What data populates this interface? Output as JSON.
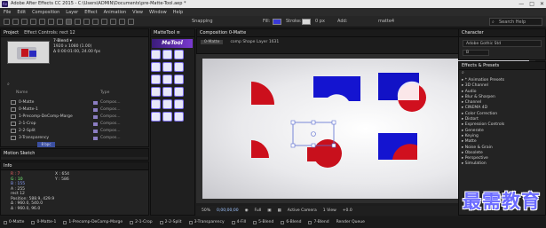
{
  "window": {
    "title": "Adobe After Effects CC 2015 - C:\\Users\\ADMIN\\Documents\\pre-Matte-Tool.aep *",
    "controls": [
      "—",
      "□",
      "✕"
    ]
  },
  "menu": [
    "File",
    "Edit",
    "Composition",
    "Layer",
    "Effect",
    "Animation",
    "View",
    "Window",
    "Help"
  ],
  "toolbar": {
    "snapping": "Snapping",
    "fill": "Fill:",
    "stroke": "Stroke:",
    "stroke_size": "0 px",
    "add": "Add:",
    "add_value": "matte4",
    "search_placeholder": "Search Help"
  },
  "project_panel": {
    "tabs": [
      "Project",
      "Effect Controls: rect 12"
    ],
    "selected_name": "7-Blend ▾",
    "selected_info1": "1920 x 1080 (1.00)",
    "selected_info2": "Δ 0:00:01:00, 24.00 fps",
    "search_icon": "⌕",
    "columns": [
      "Name",
      "Type"
    ],
    "items": [
      {
        "name": "0-Matte",
        "type": "Compos..."
      },
      {
        "name": "0-Matte-1",
        "type": "Compos..."
      },
      {
        "name": "1-Precomp-DeComp-Marge",
        "type": "Compos..."
      },
      {
        "name": "2-1-Crop",
        "type": "Compos..."
      },
      {
        "name": "2-2-Split",
        "type": "Compos..."
      },
      {
        "name": "3-Transparency",
        "type": "Compos..."
      },
      {
        "name": "4-Fill",
        "type": "Compos..."
      },
      {
        "name": "5-Blend",
        "type": "Compos..."
      }
    ],
    "bpc": "8 bpc"
  },
  "motion_sketch": {
    "tab": "Motion Sketch"
  },
  "info_panel": {
    "tab": "Info",
    "r": "R : 7",
    "g": "G : 10",
    "b": "B : 155",
    "a": "A : 255",
    "x": "X : 654",
    "y": "Y : 586",
    "layer": "rect 12",
    "position": "Position: 588.9, 429.9",
    "delta1": "Δ : 960.0, 540.0",
    "delta2": "Δ : 960.0, 96.0"
  },
  "matte_tool": {
    "tab": "MatteTool ≡",
    "logo": "MeTool"
  },
  "composition": {
    "tab": "Composition 0-Matte",
    "sub_tab": "0-Matte",
    "layer_label": "comp Shape Layer 1631",
    "zoom": "50%",
    "timecode": "0;00;00;00",
    "resolution": "Full",
    "camera": "Active Camera",
    "view": "1 View",
    "offset": "+0.0"
  },
  "character_panel": {
    "tab": "Character",
    "font": "Adobe Gothic Std",
    "style": "B"
  },
  "effects_panel": {
    "tab": "Effects & Presets",
    "search_icon": "⌕",
    "items": [
      "* Animation Presets",
      "3D Channel",
      "Audio",
      "Blur & Sharpen",
      "Channel",
      "CINEMA 4D",
      "Color Correction",
      "Distort",
      "Expression Controls",
      "Generate",
      "Keying",
      "Matte",
      "Noise & Grain",
      "Obsolete",
      "Perspective",
      "Simulation"
    ]
  },
  "timeline_tabs": [
    "0-Matte",
    "0-Matte-1",
    "1-Precomp-DeComp-Marge",
    "2-1-Crop",
    "2-2-Split",
    "3-Transparency",
    "4-Fill",
    "5-Blend",
    "6-Blend",
    "7-Blend",
    "Render Queue"
  ],
  "watermark": "最需教育",
  "colors": {
    "accent": "#6b6bff",
    "shape_blue": "#1a1ad6",
    "shape_red": "#d20d1e",
    "panel": "#232323"
  }
}
